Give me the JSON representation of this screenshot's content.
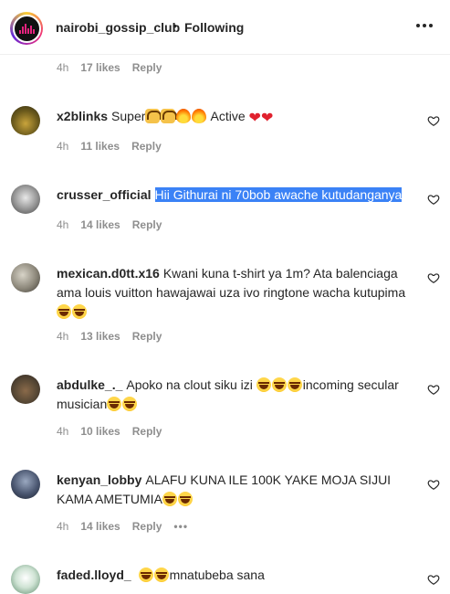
{
  "header": {
    "username": "nairobi_gossip_club",
    "separator": "•",
    "follow_status": "Following",
    "avatar_icon": "nairobi-gossip-logo-icon",
    "more_icon": "more-horizontal-icon"
  },
  "colors": {
    "selection": "#3b82f6",
    "meta": "#8e8e8e",
    "text": "#262626",
    "heart": "#e0212e"
  },
  "partial": {
    "time": "4h",
    "likes": "17 likes",
    "reply": "Reply"
  },
  "comments": [
    {
      "username": "x2blinks",
      "text_before": "Super",
      "emojis_a": [
        "raising-hands-icon",
        "raising-hands-icon",
        "fire-icon",
        "fire-icon"
      ],
      "text_after": " Active ",
      "emojis_b": [
        "red-heart-icon",
        "red-heart-icon"
      ],
      "time": "4h",
      "likes": "11 likes",
      "reply": "Reply"
    },
    {
      "username": "crusser_official",
      "text": "Hii Githurai ni 70bob awache kutudanganya",
      "time": "4h",
      "likes": "14 likes",
      "reply": "Reply"
    },
    {
      "username": "mexican.d0tt.x16",
      "text": "Kwani kuna t-shirt ya 1m? Ata balenciaga ama louis vuitton hawajawai uza ivo ringtone wacha kutupima",
      "emojis_end": [
        "face-with-tears-of-joy-icon",
        "face-with-tears-of-joy-icon"
      ],
      "time": "4h",
      "likes": "13 likes",
      "reply": "Reply"
    },
    {
      "username": "abdulke_._",
      "text_before": "Apoko na clout siku izi ",
      "text_after": "incoming secular musician",
      "time": "4h",
      "likes": "10 likes",
      "reply": "Reply"
    },
    {
      "username": "kenyan_lobby",
      "text": "ALAFU KUNA ILE 100K YAKE MOJA SIJUI KAMA AMETUMIA",
      "time": "4h",
      "likes": "14 likes",
      "reply": "Reply",
      "more": "•••"
    },
    {
      "username": "faded.lloyd_",
      "text_after": "mnatubeba sana"
    }
  ]
}
